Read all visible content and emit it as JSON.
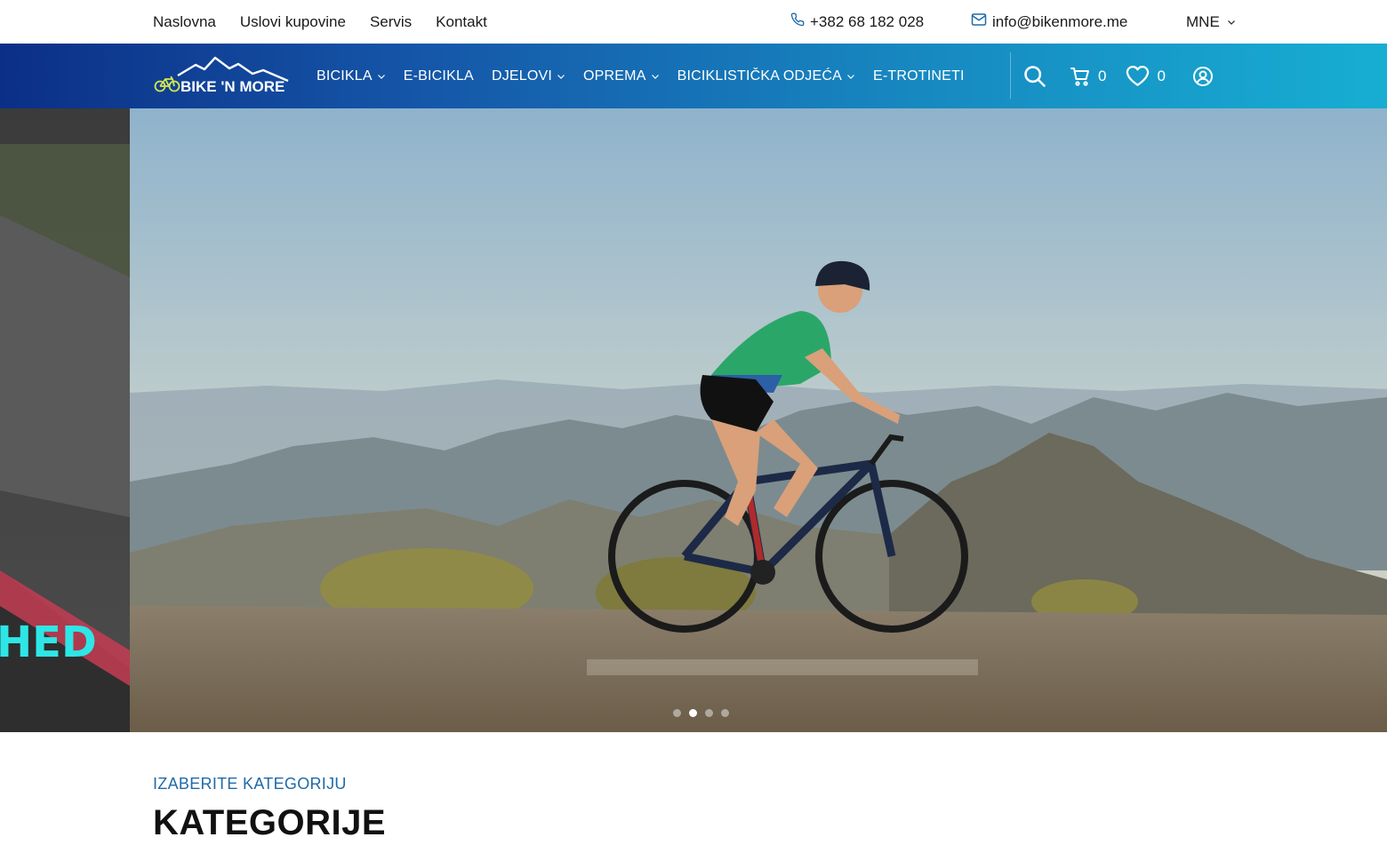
{
  "topbar": {
    "links": [
      "Naslovna",
      "Uslovi kupovine",
      "Servis",
      "Kontakt"
    ],
    "phone": "+382 68 182 028",
    "email": "info@bikenmore.me",
    "language": "MNE"
  },
  "nav": {
    "logo_text": "BIKE 'N MORE",
    "items": [
      {
        "label": "BICIKLA",
        "has_dropdown": true
      },
      {
        "label": "E-BICIKLA",
        "has_dropdown": false
      },
      {
        "label": "DJELOVI",
        "has_dropdown": true
      },
      {
        "label": "OPREMA",
        "has_dropdown": true
      },
      {
        "label": "BICIKLISTIČKA ODJEĆA",
        "has_dropdown": true
      },
      {
        "label": "E-TROTINETI",
        "has_dropdown": false
      }
    ],
    "cart_count": "0",
    "wishlist_count": "0",
    "icons": [
      "search-icon",
      "cart-icon",
      "heart-icon",
      "user-icon"
    ]
  },
  "hero": {
    "side_text": "HED",
    "slides": 4,
    "active_slide": 2
  },
  "categories": {
    "eyebrow": "IZABERITE KATEGORIJU",
    "title": "KATEGORIJE"
  },
  "colors": {
    "nav_start": "#0b2f86",
    "nav_end": "#17aed2",
    "eyebrow": "#1f6aa8",
    "side_text": "#2ee6e6"
  }
}
